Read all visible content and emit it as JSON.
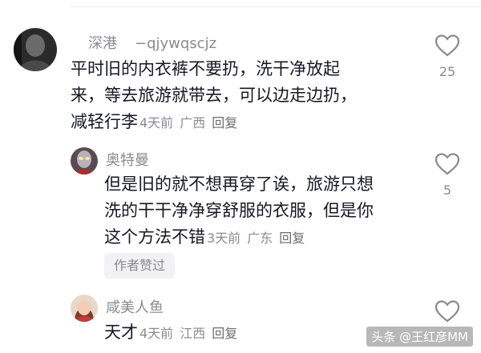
{
  "comments": [
    {
      "username": "深港",
      "user_id": "−qjywqscjz",
      "text_lines": [
        "平时旧的内衣裤不要扔，洗干净放起",
        "来，等去旅游就带去，可以边走边扔，",
        "减轻行李"
      ],
      "time": "4天前",
      "location": "广西",
      "reply_label": "回复",
      "likes": "25",
      "avatar_icon": "user-avatar-dark-icon"
    },
    {
      "username": "奥特曼",
      "text_lines": [
        "但是旧的就不想再穿了诶，旅游只想",
        "洗的干干净净穿舒服的衣服，但是你",
        "这个方法不错"
      ],
      "time": "3天前",
      "location": "广东",
      "reply_label": "回复",
      "likes": "5",
      "badge": "作者赞过",
      "avatar_icon": "ultraman-avatar-icon"
    },
    {
      "username": "咸美人鱼",
      "text_lines": [
        "天才"
      ],
      "time": "4天前",
      "location": "江西",
      "reply_label": "回复",
      "avatar_icon": "mermaid-avatar-icon"
    }
  ],
  "watermark": "头条 @王红彦MM",
  "colors": {
    "text": "#161823",
    "meta": "#8a8b91",
    "badge_bg": "#f2f2f4"
  }
}
